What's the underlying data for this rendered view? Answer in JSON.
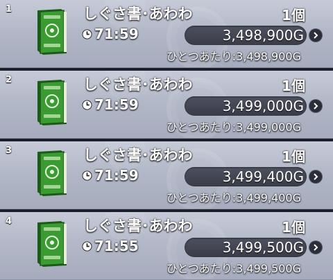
{
  "listings": [
    {
      "rank": "1",
      "name": "しぐさ書･あわわ",
      "quantity": "1個",
      "time": "71:59",
      "price": "3,498,900G",
      "unit_price": "ひとつあたり:3,498,900G"
    },
    {
      "rank": "2",
      "name": "しぐさ書･あわわ",
      "quantity": "1個",
      "time": "71:59",
      "price": "3,499,000G",
      "unit_price": "ひとつあたり:3,499,000G"
    },
    {
      "rank": "3",
      "name": "しぐさ書･あわわ",
      "quantity": "1個",
      "time": "71:59",
      "price": "3,499,400G",
      "unit_price": "ひとつあたり:3,499,400G"
    },
    {
      "rank": "4",
      "name": "しぐさ書･あわわ",
      "quantity": "1個",
      "time": "71:55",
      "price": "3,499,500G",
      "unit_price": "ひとつあたり:3,499,500G"
    }
  ],
  "icons": {
    "item": "green-book-icon",
    "time": "clock-icon",
    "open": "chevron-right-icon"
  },
  "colors": {
    "row_bg": "#b8bccb",
    "book": "#2f8a2a",
    "price_bar": "#3d3f4b",
    "text": "#ffffff"
  }
}
